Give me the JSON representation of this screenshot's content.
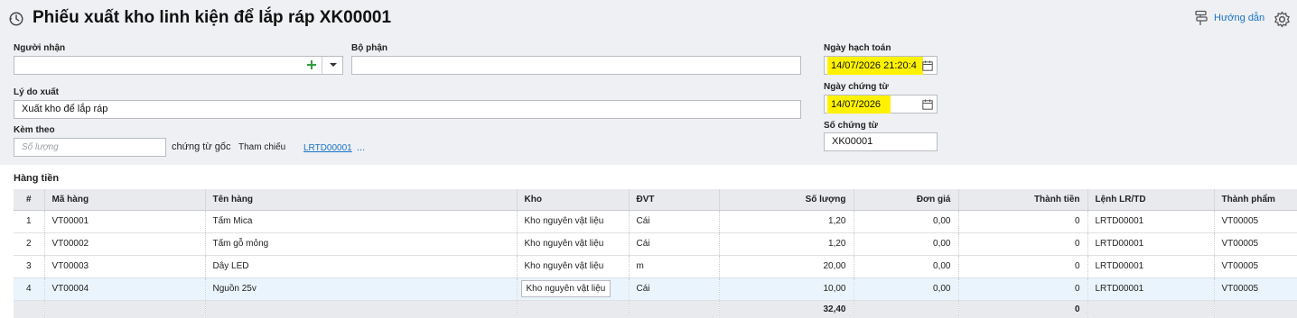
{
  "header": {
    "title": "Phiếu xuất kho linh kiện để lắp ráp XK00001",
    "guide_label": "Hướng dẫn",
    "history_icon": "history-icon",
    "settings_icon": "gear-icon"
  },
  "form": {
    "recipient": {
      "label": "Người nhận",
      "value": ""
    },
    "department": {
      "label": "Bộ phận",
      "value": ""
    },
    "reason": {
      "label": "Lý do xuất",
      "value": "Xuất kho để lắp ráp"
    },
    "attached": {
      "label": "Kèm theo",
      "placeholder": "Số lượng",
      "suffix": "chứng từ gốc"
    },
    "reference": {
      "label": "Tham chiếu",
      "link": "LRTD00001",
      "more": "..."
    },
    "posting_date": {
      "label": "Ngày hạch toán",
      "value": "14/07/2026 21:20:4"
    },
    "doc_date": {
      "label": "Ngày chứng từ",
      "value": "14/07/2026"
    },
    "doc_no": {
      "label": "Số chứng từ",
      "value": "XK00001"
    }
  },
  "section": {
    "title": "Hàng tiền"
  },
  "table": {
    "headers": [
      "#",
      "Mã hàng",
      "Tên hàng",
      "Kho",
      "ĐVT",
      "Số lượng",
      "Đơn giá",
      "Thành tiền",
      "Lệnh LR/TD",
      "Thành phẩm"
    ],
    "rows": [
      [
        "1",
        "VT00001",
        "Tấm Mica",
        "Kho nguyên vật liệu",
        "Cái",
        "1,20",
        "0,00",
        "0",
        "LRTD00001",
        "VT00005"
      ],
      [
        "2",
        "VT00002",
        "Tấm gỗ mỏng",
        "Kho nguyên vật liệu",
        "Cái",
        "1,20",
        "0,00",
        "0",
        "LRTD00001",
        "VT00005"
      ],
      [
        "3",
        "VT00003",
        "Dây LED",
        "Kho nguyên vật liệu",
        "m",
        "20,00",
        "0,00",
        "0",
        "LRTD00001",
        "VT00005"
      ],
      [
        "4",
        "VT00004",
        "Nguồn 25v",
        "Kho nguyên vật liệu",
        "Cái",
        "10,00",
        "0,00",
        "0",
        "LRTD00001",
        "VT00005"
      ]
    ],
    "totals": {
      "quantity": "32,40",
      "amount": "0"
    }
  },
  "colors": {
    "accent": "#1a73c8",
    "highlight": "#fff200",
    "plus": "#2e9e3e",
    "selected_row": "#eaf4fd"
  }
}
